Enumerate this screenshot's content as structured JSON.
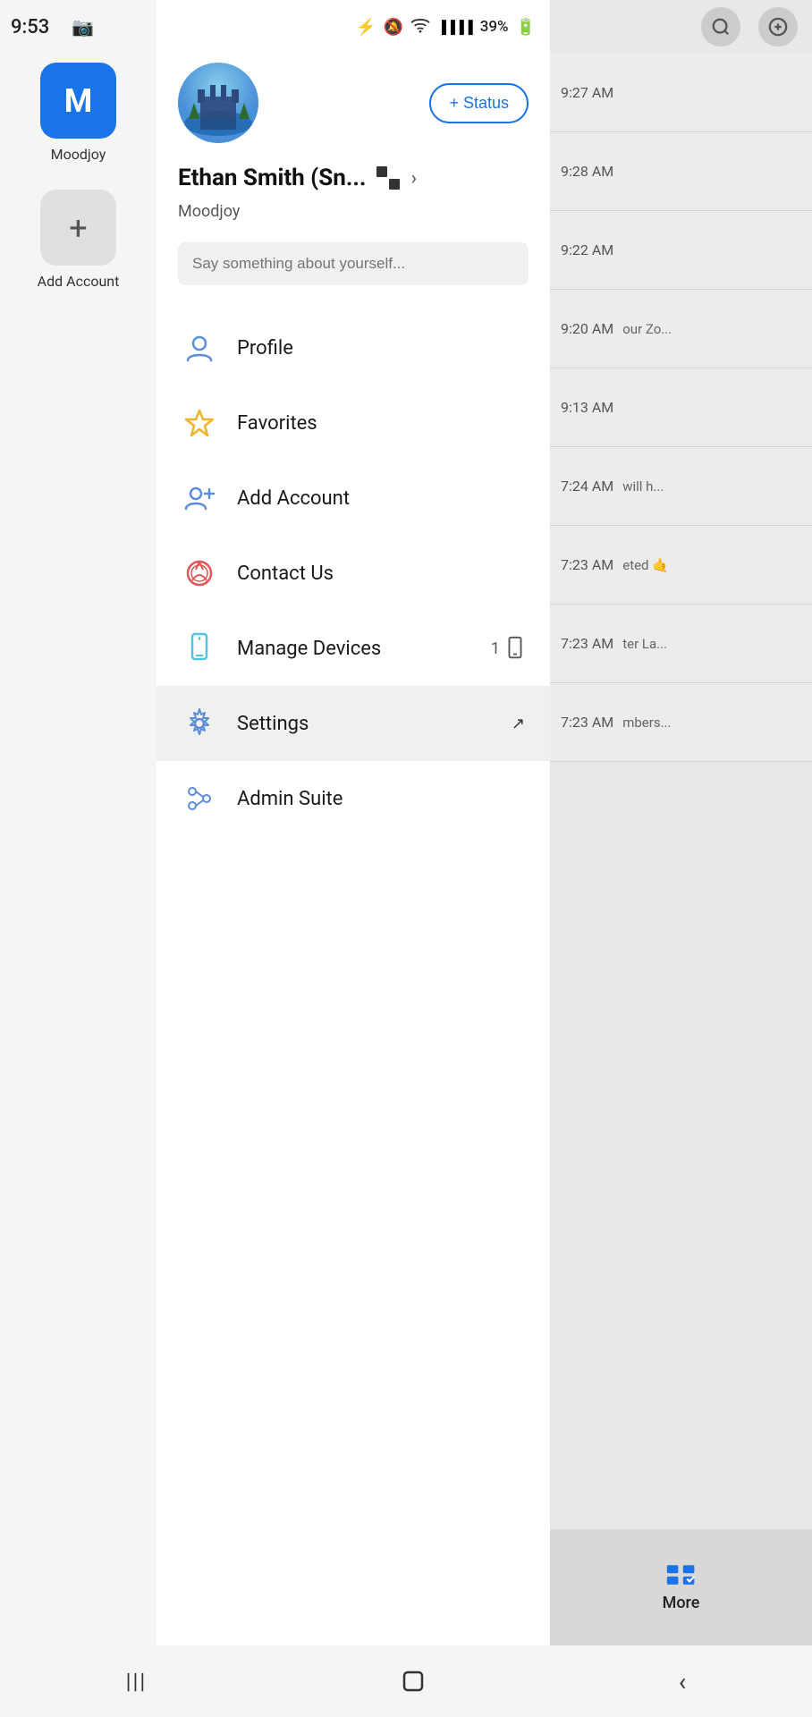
{
  "statusBar": {
    "time": "9:53",
    "battery": "39%",
    "icons": [
      "bluetooth",
      "mute",
      "wifi",
      "signal"
    ]
  },
  "sidebar": {
    "account": {
      "initial": "M",
      "label": "Moodjoy"
    },
    "addAccount": {
      "label": "Add Account"
    }
  },
  "drawer": {
    "avatar_alt": "Profile photo",
    "statusBtn": "+ Status",
    "userName": "Ethan Smith (Sn...",
    "organization": "Moodjoy",
    "statusPlaceholder": "Say something about yourself...",
    "menuItems": [
      {
        "id": "profile",
        "label": "Profile",
        "icon": "person",
        "iconColor": "#5b8dd9"
      },
      {
        "id": "favorites",
        "label": "Favorites",
        "icon": "star",
        "iconColor": "#f0b429"
      },
      {
        "id": "add-account",
        "label": "Add Account",
        "icon": "add-person",
        "iconColor": "#5b8dd9"
      },
      {
        "id": "contact-us",
        "label": "Contact Us",
        "icon": "headset",
        "iconColor": "#e05555"
      },
      {
        "id": "manage-devices",
        "label": "Manage Devices",
        "icon": "phone",
        "iconColor": "#4fc3e0",
        "badge": "1"
      },
      {
        "id": "settings",
        "label": "Settings",
        "icon": "gear",
        "iconColor": "#5b8dd9",
        "active": true
      },
      {
        "id": "admin-suite",
        "label": "Admin Suite",
        "icon": "sliders",
        "iconColor": "#5b8dd9"
      }
    ]
  },
  "chatPeek": {
    "times": [
      "9:27 AM",
      "9:28 AM",
      "9:22 AM",
      "9:20 AM",
      "9:13 AM",
      "7:24 AM",
      "7:23 AM",
      "7:23 AM",
      "7:23 AM"
    ],
    "previews": [
      "",
      "",
      "",
      "our Zo...",
      "",
      "will h...",
      "eted 🤙",
      "ter La...",
      "mbers..."
    ]
  },
  "bottomMore": {
    "label": "More"
  },
  "navBar": {
    "menu": "|||",
    "home": "○",
    "back": "<"
  }
}
